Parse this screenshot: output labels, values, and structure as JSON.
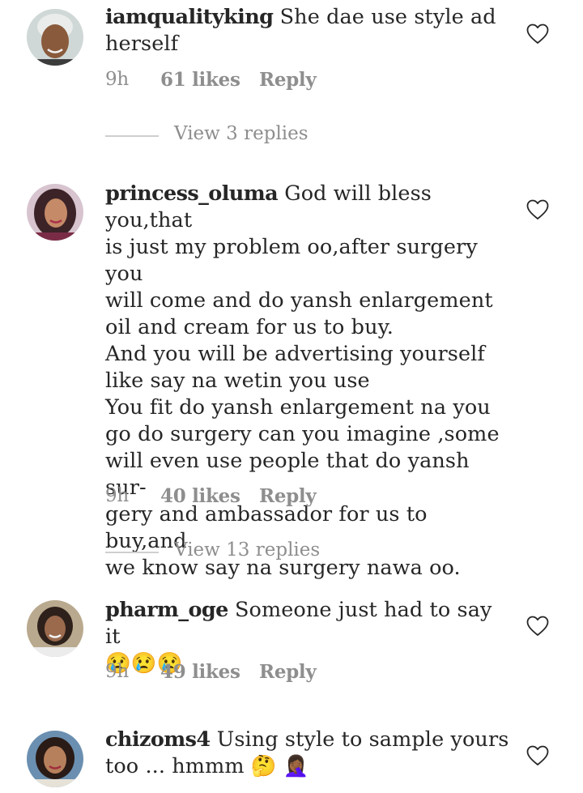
{
  "comments": [
    {
      "username": "iamqualityking",
      "text": " She dae use style ad\nherself",
      "time": "9h",
      "likes": "61 likes",
      "reply": "Reply",
      "view_replies": "View 3 replies"
    },
    {
      "username": "princess_oluma",
      "text": " God will bless you,that\nis just my problem oo,after surgery you\nwill come and do yansh enlargement\noil and cream for us to buy.\nAnd you will be advertising yourself\nlike say na wetin you use\nYou fit do yansh enlargement na you\ngo do surgery can you imagine ,some\nwill even use people that do yansh sur-\ngery and ambassador for us to buy,and\nwe know say na surgery nawa oo.",
      "time": "9h",
      "likes": "40 likes",
      "reply": "Reply",
      "view_replies": "View 13 replies"
    },
    {
      "username": "pharm_oge",
      "text": " Someone just had to say it\n😢😢😢",
      "time": "9h",
      "likes": "49 likes",
      "reply": "Reply"
    },
    {
      "username": "chizoms4",
      "text": " Using style to sample yours\ntoo ... hmmm 🤔 🤦🏾‍♀️"
    }
  ],
  "icons": {
    "like": "heart-outline-icon"
  },
  "colors": {
    "text": "#262626",
    "secondary": "#8e8e8e",
    "divider": "#cfcfcf"
  }
}
